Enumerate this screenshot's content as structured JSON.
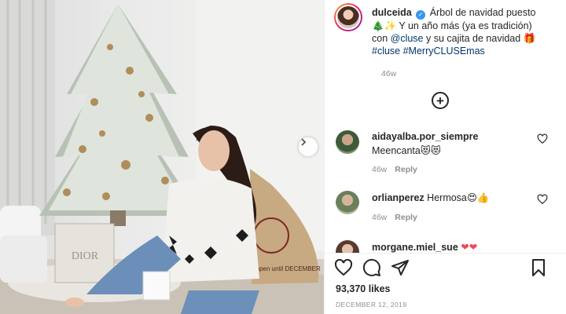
{
  "post": {
    "username": "dulceida",
    "caption_main": " Árbol de navidad puesto",
    "caption_line2": " Y un año más (ya es tradición)",
    "caption_con": "con ",
    "mention": "@cluse",
    "caption_tail": " y su cajita de navidad",
    "hashtags": "#cluse #MerryCLUSEmas",
    "time": "46w",
    "likes": "93,370 likes",
    "date": "DECEMBER 12, 2019",
    "photo_text_box": "DIOR",
    "photo_text_sack": "not open until DECEMBER"
  },
  "comments": [
    {
      "username": "aidayalba.por_siempre",
      "text": "Meencanta",
      "emoji": "😻😻",
      "time": "46w",
      "reply": "Reply"
    },
    {
      "username": "orlianperez",
      "text": "Hermosa",
      "emoji": "😍👍",
      "time": "46w",
      "reply": "Reply"
    },
    {
      "username": "morgane.miel_sue",
      "text": "",
      "emoji": "❤❤",
      "time": "",
      "reply": ""
    }
  ],
  "icons": {
    "verified": "verified-badge-icon",
    "load_more": "plus-circle-icon",
    "next": "chevron-right-icon",
    "like": "heart-icon",
    "comment": "comment-icon",
    "share": "share-icon",
    "save": "bookmark-icon"
  },
  "colors": {
    "accent_blue": "#3897f0",
    "link": "#00376b",
    "muted": "#8e8e8e",
    "text": "#262626",
    "heart_red": "#ed4956"
  }
}
